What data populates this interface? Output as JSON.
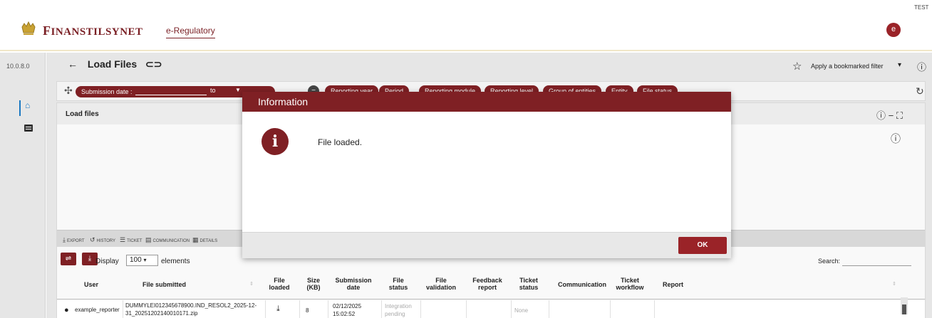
{
  "header": {
    "brand": "FINANSTILSYNET",
    "app_link": "e-Regulatory",
    "environment": "TEST",
    "avatar_initial": "e"
  },
  "sidebar": {
    "version": "10.0.8.0",
    "items": [
      {
        "icon": "home-icon"
      },
      {
        "icon": "chat-icon"
      }
    ]
  },
  "page": {
    "title": "Load Files",
    "bookmark_filter": "Apply a bookmarked filter"
  },
  "filter": {
    "submission_date_label": "Submission date :",
    "to_label": "to",
    "chips": [
      "Reporting year",
      "Period",
      "Reporting module",
      "Reporting level",
      "Group of entities",
      "Entity",
      "File status"
    ]
  },
  "panel": {
    "title": "Load files",
    "toolbar": [
      "EXPORT",
      "HISTORY",
      "TICKET",
      "COMMUNICATION",
      "DETAILS"
    ],
    "display_label": "Display",
    "display_value": "100",
    "elements_label": "elements",
    "search_label": "Search:"
  },
  "table": {
    "columns": [
      {
        "key": "user",
        "label": "User"
      },
      {
        "key": "file_submitted",
        "label": "File submitted"
      },
      {
        "key": "file_loaded",
        "label": "File loaded"
      },
      {
        "key": "size",
        "label": "Size (KB)"
      },
      {
        "key": "submission_date",
        "label": "Submission date"
      },
      {
        "key": "file_status",
        "label": "File status"
      },
      {
        "key": "file_validation",
        "label": "File validation"
      },
      {
        "key": "feedback_report",
        "label": "Feedback report"
      },
      {
        "key": "ticket_status",
        "label": "Ticket status"
      },
      {
        "key": "communication",
        "label": "Communication"
      },
      {
        "key": "ticket_workflow",
        "label": "Ticket workflow"
      },
      {
        "key": "report",
        "label": "Report"
      }
    ],
    "rows": [
      {
        "user": "example_reporter",
        "file_submitted": "DUMMYLEI012345678900.IND_RESOL2_2025-12-31_20251202140010171.zip",
        "size": "8",
        "submission_date": "02/12/2025 15:02:52",
        "file_status": "Integration pending",
        "ticket_status": "None"
      }
    ]
  },
  "dialog": {
    "title": "Information",
    "message": "File loaded.",
    "ok_label": "OK",
    "icon_glyph": "i"
  },
  "colors": {
    "brand": "#7f2024",
    "accent": "#1a78c2"
  }
}
